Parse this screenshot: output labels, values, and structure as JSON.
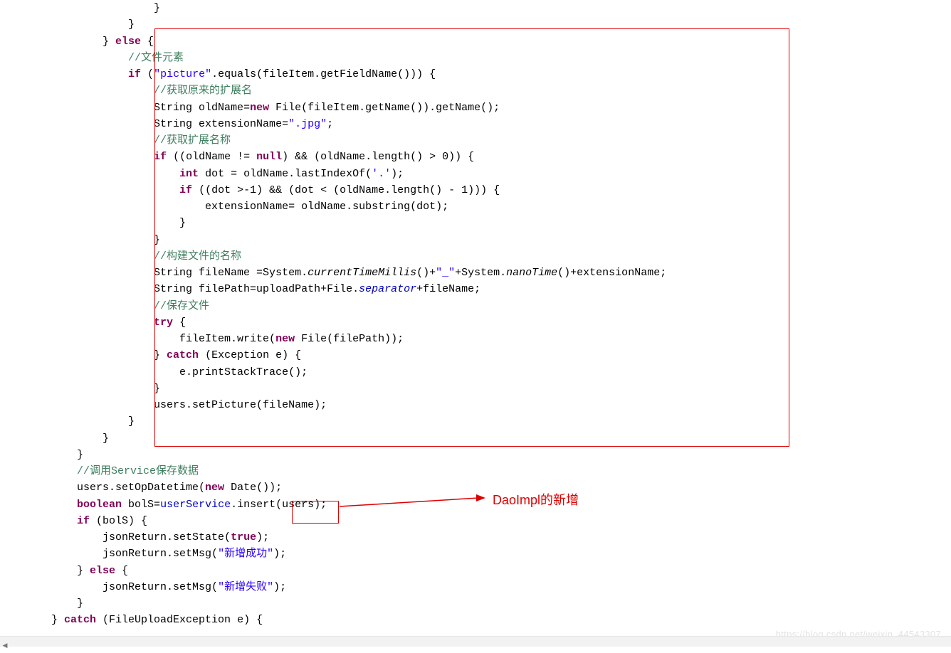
{
  "code": {
    "l1a": "                        }",
    "l1b": "                    }",
    "l2a": "                } ",
    "l2k": "else",
    "l2b": " {",
    "l3a": "                    ",
    "l3c": "//文件元素",
    "l4a": "                    ",
    "l4k": "if",
    "l4b": " (",
    "l4s": "\"picture\"",
    "l4c": ".equals(fileItem.getFieldName())) {",
    "l5a": "                        ",
    "l5c": "//获取原来的扩展名",
    "l6a": "                        String oldName=",
    "l6k": "new",
    "l6b": " File(fileItem.getName()).getName();",
    "l7a": "                        String extensionName=",
    "l7s": "\".jpg\"",
    "l7b": ";",
    "l8a": "                        ",
    "l8c": "//获取扩展名称",
    "l9a": "                        ",
    "l9k1": "if",
    "l9b": " ((oldName != ",
    "l9k2": "null",
    "l9c": ") && (oldName.length() > 0)) {",
    "l10a": "                            ",
    "l10k": "int",
    "l10b": " dot = oldName.lastIndexOf(",
    "l10s": "'.'",
    "l10c": ");",
    "l11a": "                            ",
    "l11k": "if",
    "l11b": " ((dot >-1) && (dot < (oldName.length() - 1))) {",
    "l12a": "                                extensionName= oldName.substring(dot);",
    "l13a": "                            }",
    "l14a": "                        }",
    "l15a": "                        ",
    "l15c": "//构建文件的名称",
    "l16a": "                        String fileName =System.",
    "l16m1": "currentTimeMillis",
    "l16b": "()+",
    "l16s": "\"_\"",
    "l16c": "+System.",
    "l16m2": "nanoTime",
    "l16d": "()+extensionName;",
    "l17a": "                        String filePath=uploadPath+File.",
    "l17f": "separator",
    "l17b": "+fileName;",
    "l18a": "                        ",
    "l18c": "//保存文件",
    "l19a": "                        ",
    "l19k": "try",
    "l19b": " {",
    "l20a": "                            fileItem.write(",
    "l20k": "new",
    "l20b": " File(filePath));",
    "l21a": "                        } ",
    "l21k": "catch",
    "l21b": " (Exception e) {",
    "l22a": "                            e.printStackTrace();",
    "l23a": "                        }",
    "l24a": "                        users.setPicture(fileName);",
    "l25a": "                    }",
    "l26a": "                }",
    "l27a": "            }",
    "l28a": "            ",
    "l28c": "//调用Service保存数据",
    "l29a": "            users.setOpDatetime(",
    "l29k": "new",
    "l29b": " Date());",
    "l30a": "            ",
    "l30k": "boolean",
    "l30b": " bolS=",
    "l30f": "userService",
    "l30c": ".insert(users);",
    "l31a": "            ",
    "l31k": "if",
    "l31b": " (bolS) {",
    "l32a": "                jsonReturn.setState(",
    "l32k": "true",
    "l32b": ");",
    "l33a": "                jsonReturn.setMsg(",
    "l33s": "\"新增成功\"",
    "l33b": ");",
    "l34a": "            } ",
    "l34k": "else",
    "l34b": " {",
    "l35a": "                jsonReturn.setMsg(",
    "l35s": "\"新增失败\"",
    "l35b": ");",
    "l36a": "            }",
    "l37a": "        } ",
    "l37k": "catch",
    "l37b": " (FileUploadException e) {"
  },
  "annotation": "DaoImpl的新增",
  "watermark": "https://blog.csdn.net/weixin_44543307"
}
